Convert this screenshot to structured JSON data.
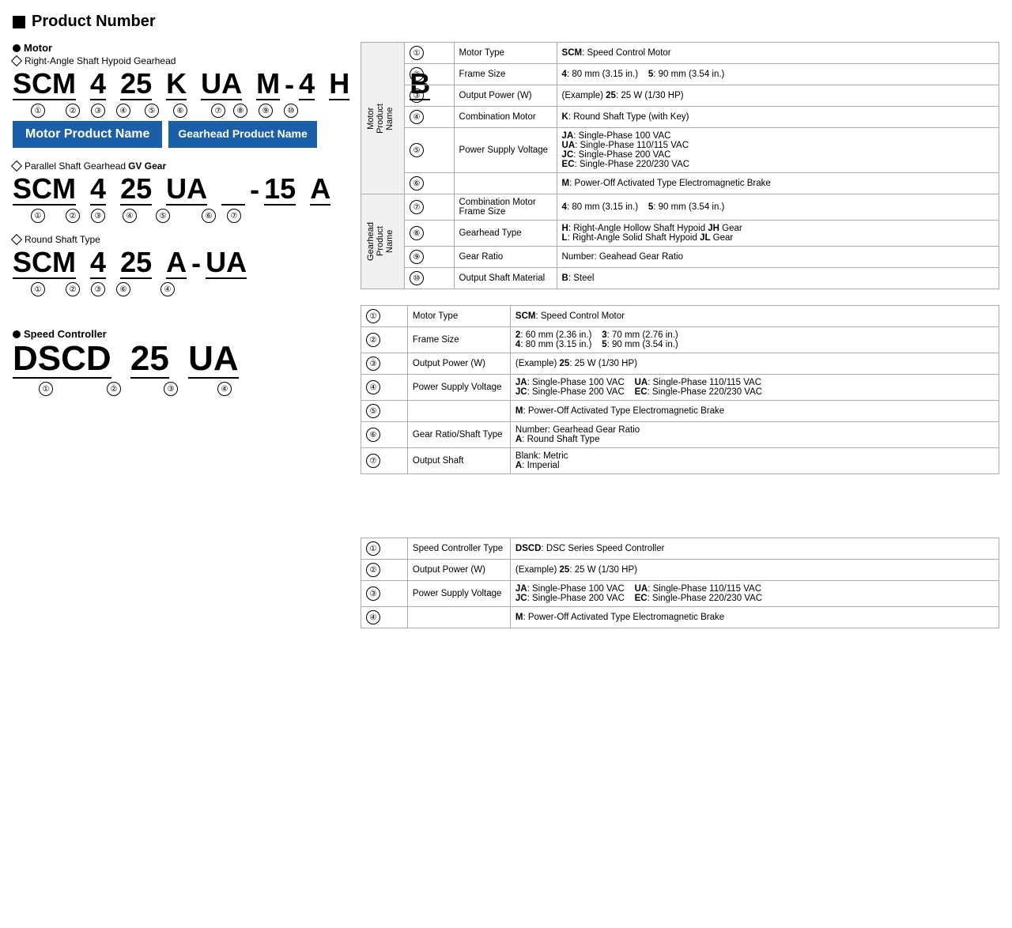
{
  "page": {
    "title": "Product Number"
  },
  "motor_section": {
    "bullet_label": "Motor",
    "right_angle_label": "Right-Angle Shaft Hypoid Gearhead",
    "product_name1": "SCM 4 25 K UA M - 4 H 10 B",
    "motor_product_name_label": "Motor Product Name",
    "gearhead_product_name_label": "Gearhead Product Name",
    "parallel_shaft_label": "Parallel Shaft Gearhead GV Gear",
    "product_name2": "SCM 4 25 UA   - 15 A",
    "round_shaft_label": "Round Shaft Type",
    "product_name3": "SCM 4 25 A - UA"
  },
  "table1": {
    "row_header": "Motor Product Name",
    "rows": [
      {
        "num": "①",
        "label": "Motor Type",
        "value": "SCM: Speed Control Motor"
      },
      {
        "num": "②",
        "label": "Frame Size",
        "value": "4: 80 mm (3.15 in.)   5: 90 mm (3.54 in.)"
      },
      {
        "num": "③",
        "label": "Output Power (W)",
        "value": "(Example) 25: 25 W (1/30 HP)"
      },
      {
        "num": "④",
        "label": "Combination Motor",
        "value": "K: Round Shaft Type (with Key)"
      },
      {
        "num": "⑤",
        "label": "Power Supply Voltage",
        "value": "JA: Single-Phase 100 VAC\nUA: Single-Phase 110/115 VAC\nJC: Single-Phase 200 VAC\nEC: Single-Phase 220/230 VAC"
      },
      {
        "num": "⑥",
        "label": "",
        "value": "M: Power-Off Activated Type Electromagnetic Brake"
      }
    ],
    "gearhead_rows": [
      {
        "num": "⑦",
        "label": "Combination Motor Frame Size",
        "value": "4: 80 mm (3.15 in.)   5: 90 mm (3.54 in.)"
      },
      {
        "num": "⑧",
        "label": "Gearhead Type",
        "value": "H: Right-Angle Hollow Shaft Hypoid JH Gear\nL: Right-Angle Solid Shaft Hypoid JL Gear"
      },
      {
        "num": "⑨",
        "label": "Gear Ratio",
        "value": "Number: Geahead Gear Ratio"
      },
      {
        "num": "⑩",
        "label": "Output Shaft Material",
        "value": "B: Steel"
      }
    ]
  },
  "table2": {
    "rows": [
      {
        "num": "①",
        "label": "Motor Type",
        "value": "SCM: Speed Control Motor"
      },
      {
        "num": "②",
        "label": "Frame Size",
        "value": "2: 60 mm (2.36 in.)   3: 70 mm (2.76 in.)\n4: 80 mm (3.15 in.)   5: 90 mm (3.54 in.)"
      },
      {
        "num": "③",
        "label": "Output Power (W)",
        "value": "(Example) 25: 25 W (1/30 HP)"
      },
      {
        "num": "④",
        "label": "Power Supply Voltage",
        "value": "JA: Single-Phase 100 VAC   UA: Single-Phase 110/115 VAC\nJC: Single-Phase 200 VAC   EC: Single-Phase 220/230 VAC"
      },
      {
        "num": "⑤",
        "label": "",
        "value": "M: Power-Off Activated Type Electromagnetic Brake"
      },
      {
        "num": "⑥",
        "label": "Gear Ratio/Shaft Type",
        "value": "Number: Gearhead Gear Ratio\nA: Round Shaft Type"
      },
      {
        "num": "⑦",
        "label": "Output Shaft",
        "value": "Blank: Metric\nA: Imperial"
      }
    ]
  },
  "speed_controller_section": {
    "bullet_label": "Speed Controller",
    "product_name": "DSCD 25 UA",
    "table_rows": [
      {
        "num": "①",
        "label": "Speed Controller Type",
        "value": "DSCD: DSC Series Speed Controller"
      },
      {
        "num": "②",
        "label": "Output Power (W)",
        "value": "(Example) 25: 25 W (1/30 HP)"
      },
      {
        "num": "③",
        "label": "Power Supply Voltage",
        "value": "JA: Single-Phase 100 VAC   UA: Single-Phase 110/115 VAC\nJC: Single-Phase 200 VAC   EC: Single-Phase 220/230 VAC"
      },
      {
        "num": "④",
        "label": "",
        "value": "M: Power-Off Activated Type Electromagnetic Brake"
      }
    ]
  }
}
